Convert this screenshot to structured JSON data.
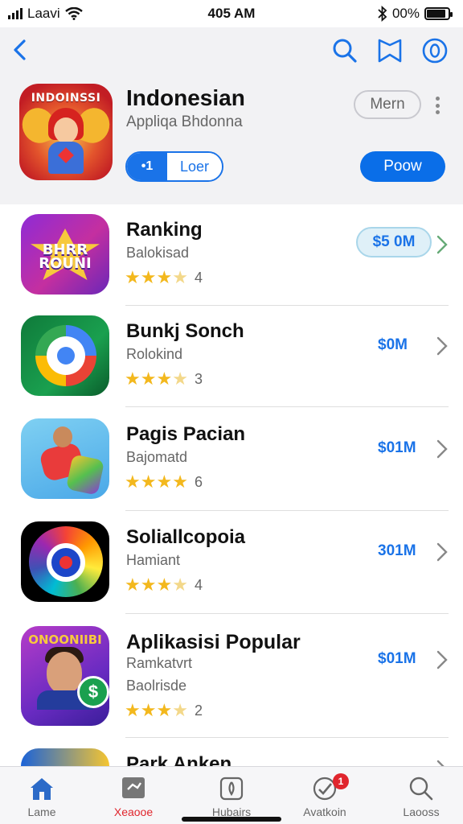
{
  "status_bar": {
    "carrier": "Laavi",
    "time": "405 AM",
    "battery_text": "00%",
    "battery_level": 0.9
  },
  "nav": {
    "back_icon": "chevron-left-icon",
    "icons": [
      "search-icon",
      "bookmark-icon",
      "info-icon"
    ]
  },
  "featured": {
    "icon_text": "INDOINSSI",
    "title": "Indonesian",
    "subtitle": "Appliqa Bhdonna",
    "pill_label": "Mern",
    "segment_left": "•1",
    "segment_right": "Loer",
    "get_label": "Poow"
  },
  "apps": [
    {
      "name": "Ranking",
      "category": "Balokisad",
      "rating": 3.5,
      "rating_count": "4",
      "price": "$5 0M",
      "icon_text": "BHRR ROUNI"
    },
    {
      "name": "Bunkj Sonch",
      "category": "Rolokind",
      "rating": 3.5,
      "rating_count": "3",
      "price": "$0M"
    },
    {
      "name": "Pagis Pacian",
      "category": "Bajomatd",
      "rating": 4,
      "rating_count": "6",
      "price": "$01M"
    },
    {
      "name": "Soliallcopoia",
      "category": "Hamiant",
      "rating": 3.5,
      "rating_count": "4",
      "price": "301M"
    },
    {
      "name": "Aplikasisi Popular",
      "category": "Ramkatvrt",
      "category2": "Baolrisde",
      "rating": 3.5,
      "rating_count": "2",
      "price": "$01M",
      "icon_text": "ONOONIIBI"
    },
    {
      "name": "Park Anken"
    }
  ],
  "tabs": [
    {
      "label": "Lame",
      "icon": "home-icon"
    },
    {
      "label": "Xeaooe",
      "icon": "today-icon"
    },
    {
      "label": "Hubairs",
      "icon": "apps-icon"
    },
    {
      "label": "Avatkoin",
      "icon": "updates-icon",
      "badge": "1"
    },
    {
      "label": "Laooss",
      "icon": "search-icon"
    }
  ],
  "colors": {
    "accent": "#1a73e8",
    "star": "#f3b81d",
    "tab_active": "#e0252d"
  }
}
